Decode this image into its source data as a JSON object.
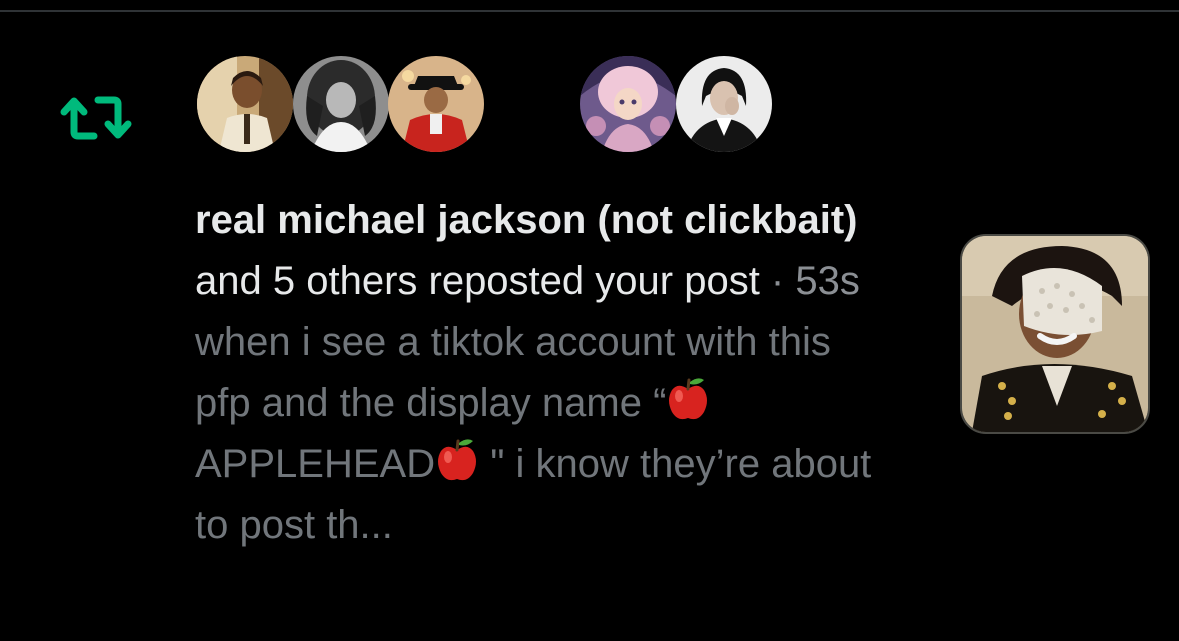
{
  "notification": {
    "type_icon": "repost-icon",
    "avatars": [
      {
        "icon": "avatar-image-1"
      },
      {
        "icon": "avatar-image-2"
      },
      {
        "icon": "avatar-image-3"
      },
      {
        "icon": "avatar-image-4"
      },
      {
        "icon": "avatar-image-5"
      }
    ],
    "actor_name": "real michael jackson (not clickbait)",
    "others_text": " and 5 others reposted your post",
    "separator": " · ",
    "timestamp": "53s",
    "excerpt_part1": "when i see a tiktok account with this pfp and the display name “",
    "excerpt_part2": "APPLEHEAD",
    "excerpt_part3": " \" i know they’re about to post th...",
    "apple_emoji": "red-apple-emoji",
    "thumbnail_icon": "post-image-thumbnail"
  },
  "colors": {
    "background": "#000000",
    "repost_green": "#00ba7c",
    "primary_text": "#e7e9ea",
    "secondary_text": "#71767b"
  }
}
